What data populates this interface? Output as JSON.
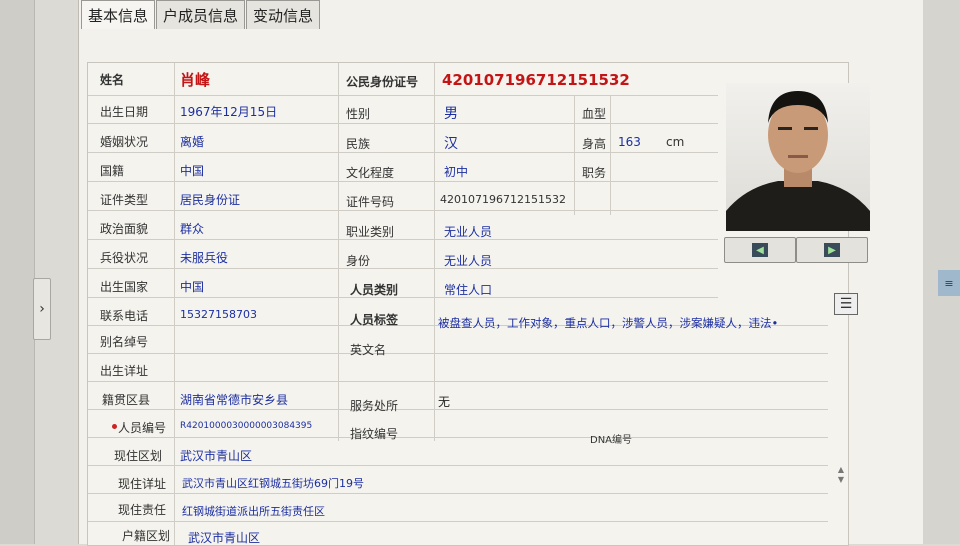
{
  "tabs": [
    {
      "label": "基本信息"
    },
    {
      "label": "户成员信息"
    },
    {
      "label": "变动信息"
    }
  ],
  "fields": {
    "name": {
      "label": "姓名",
      "value": "肖峰"
    },
    "id_number_head": {
      "label": "公民身份证号",
      "value": "420107196712151532"
    },
    "birth_date": {
      "label": "出生日期",
      "value": "1967年12月15日"
    },
    "gender": {
      "label": "性别",
      "value": "男"
    },
    "blood_type": {
      "label": "血型",
      "value": ""
    },
    "marital": {
      "label": "婚姻状况",
      "value": "离婚"
    },
    "ethnicity": {
      "label": "民族",
      "value": "汉"
    },
    "height": {
      "label": "身高",
      "value": "163",
      "unit": "cm"
    },
    "nationality": {
      "label": "国籍",
      "value": "中国"
    },
    "education": {
      "label": "文化程度",
      "value": "初中"
    },
    "position": {
      "label": "职务",
      "value": ""
    },
    "doc_type": {
      "label": "证件类型",
      "value": "居民身份证"
    },
    "doc_number": {
      "label": "证件号码",
      "value": "420107196712151532"
    },
    "political": {
      "label": "政治面貌",
      "value": "群众"
    },
    "occupation": {
      "label": "职业类别",
      "value": "无业人员"
    },
    "military": {
      "label": "兵役状况",
      "value": "未服兵役"
    },
    "identity": {
      "label": "身份",
      "value": "无业人员"
    },
    "birth_country": {
      "label": "出生国家",
      "value": "中国"
    },
    "person_category": {
      "label": "人员类别",
      "value": "常住人口"
    },
    "phone": {
      "label": "联系电话",
      "value": "15327158703"
    },
    "person_tags": {
      "label": "人员标签",
      "value": "被盘查人员，工作对象，重点人口，涉警人员，涉案嫌疑人，违法•"
    },
    "alias": {
      "label": "别名绰号",
      "value": ""
    },
    "english_name": {
      "label": "英文名",
      "value": ""
    },
    "birth_detail": {
      "label": "出生详址",
      "value": ""
    },
    "native_place": {
      "label": "籍贯区县",
      "value": "湖南省常德市安乡县"
    },
    "service": {
      "label": "服务处所",
      "value": "无"
    },
    "person_no": {
      "label": "人员编号",
      "value": "R4201000030000003084395"
    },
    "fingerprint": {
      "label": "指纹编号",
      "value": ""
    },
    "dna": {
      "label": "DNA编号",
      "value": ""
    },
    "current_district": {
      "label": "现住区划",
      "value": "武汉市青山区"
    },
    "current_address": {
      "label": "现住详址",
      "value": "武汉市青山区红钢城五街坊69门19号"
    },
    "current_duty": {
      "label": "现住责任",
      "value": "红钢城街道派出所五街责任区"
    },
    "household_district": {
      "label": "户籍区划",
      "value": "武汉市青山区"
    }
  },
  "photo": {
    "nav_prev": "◀",
    "nav_next": "▶"
  },
  "colors": {
    "label": "#333333",
    "value": "#1d2fa0",
    "highlight": "#c31515"
  }
}
